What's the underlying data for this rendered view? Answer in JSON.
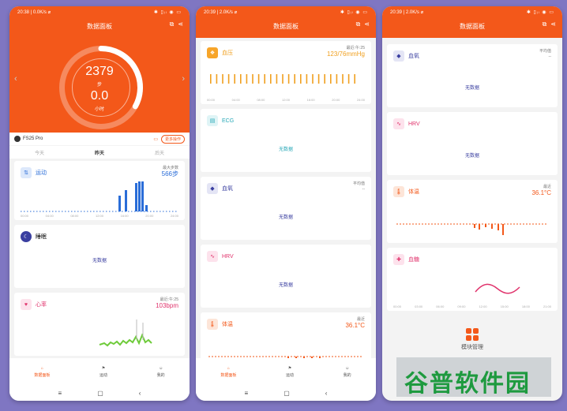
{
  "status": {
    "p1_time": "20:38",
    "p1_net": "0.0K/s ⌀",
    "p2_time": "20:39",
    "p2_net": "2.0K/s ⌀",
    "p3_time": "20:39",
    "p3_net": "2.0K/s ⌀",
    "right": "✱ ▯ᵢₗ ◉ ▭"
  },
  "header": {
    "title": "数据面板",
    "icon_edit": "⧉",
    "icon_share": "⋖"
  },
  "activity": {
    "steps": "2379",
    "steps_unit": "步",
    "hours": "0.0",
    "hours_unit": "小时",
    "ring_progress": 0.33
  },
  "device": {
    "name": "FS25 Pro",
    "battery": "▭",
    "more_button": "更多操作"
  },
  "date_tabs": [
    "今天",
    "昨天",
    "后天"
  ],
  "cards": {
    "exercise": {
      "title": "运动",
      "meta_label": "最大步数",
      "meta_value": "566步",
      "icon": "exercise-icon",
      "color": "#2a6dd8"
    },
    "sleep": {
      "title": "睡眠",
      "nodata": "无数据",
      "icon": "moon-icon",
      "color": "#3a3fa0"
    },
    "heart": {
      "title": "心率",
      "meta_label": "最近:午:25",
      "meta_value": "103bpm",
      "icon": "heart-icon",
      "color": "#e0336c"
    },
    "bp": {
      "title": "血压",
      "meta_label": "最近:午:25",
      "meta_value": "123/76mmHg",
      "icon": "blood-pressure-icon",
      "color": "#f0a020"
    },
    "ecg": {
      "title": "ECG",
      "nodata": "无数据",
      "icon": "ecg-icon",
      "color": "#2aa9b8"
    },
    "spo2": {
      "title": "血氧",
      "meta_label": "平均值",
      "meta_value": "--",
      "nodata": "无数据",
      "icon": "blood-drop-icon",
      "color": "#3a3fa0"
    },
    "hrv": {
      "title": "HRV",
      "nodata": "无数据",
      "icon": "hrv-icon",
      "color": "#e0336c"
    },
    "temp": {
      "title": "体温",
      "meta_label": "最近",
      "meta_value": "36.1°C",
      "icon": "thermometer-icon",
      "color": "#f3581a"
    },
    "glucose": {
      "title": "血糖",
      "icon": "glucose-icon",
      "color": "#e0336c"
    }
  },
  "xlabels": [
    "00:00",
    "04:00",
    "08:00",
    "12:00",
    "16:00",
    "20:00",
    "24:00"
  ],
  "temp_xlabels": [
    "00:00",
    "03:00",
    "06:00",
    "09:00",
    "12:00",
    "15:00",
    "18:00",
    "21:00"
  ],
  "nav": {
    "dashboard": "数据面板",
    "exercise": "运动",
    "me": "我的"
  },
  "sysnav": {
    "menu": "≡",
    "home": "▢",
    "back": "‹"
  },
  "card_manage": "模块管理",
  "watermark": "谷普软件园"
}
